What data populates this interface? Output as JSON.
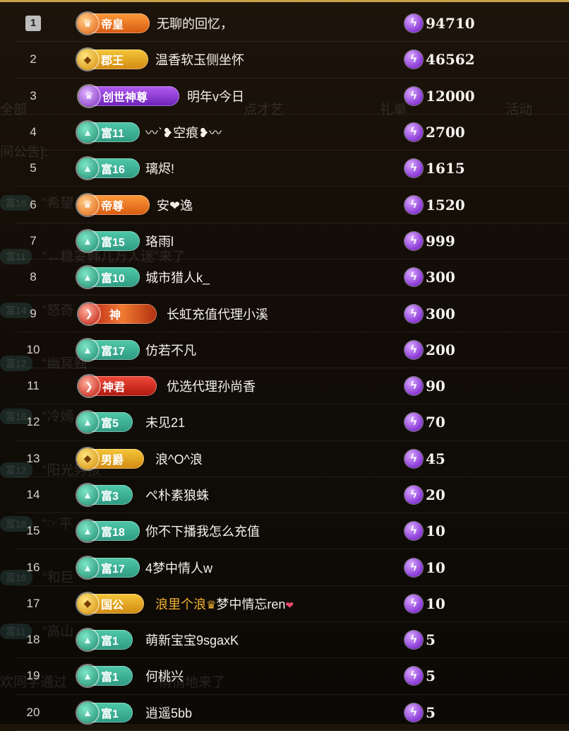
{
  "background": {
    "tabs": [
      "全部",
      "点才艺",
      "礼单",
      "活动"
    ],
    "announcement": "间公告]:",
    "chat_tags": [
      "富16",
      "富11",
      "富14",
      "富12",
      "富16",
      "富12",
      "富18",
      "富16",
      "富11"
    ],
    "chat_lines": [
      "“希望",
      "“↔稳妥韩几万人迷”来了",
      "“怒奇",
      "“幽冥独",
      "“冷嫣",
      "“阳光男孩",
      "“☞平",
      "“和巨",
      "“高山",
      "欢同学通过",
      "悄悄地来了"
    ]
  },
  "colors": {
    "accent_gold": "#c8a14a",
    "rich_badge": "#3fb596",
    "score_icon": "#8a3ad6"
  },
  "ranking": [
    {
      "rank": "1",
      "badge": "帝皇",
      "badge_type": "orange",
      "name": "无聊的回忆，",
      "score": "94710"
    },
    {
      "rank": "2",
      "badge": "郡王",
      "badge_type": "gold",
      "name": "温香软玉侧坐怀",
      "score": "46562"
    },
    {
      "rank": "3",
      "badge": "创世神尊",
      "badge_type": "purple",
      "name": "明年v今日",
      "score": "12000"
    },
    {
      "rank": "4",
      "badge": "富11",
      "badge_type": "rich",
      "name": "〰ˋ❥空痕❥〰",
      "score": "2700"
    },
    {
      "rank": "5",
      "badge": "富16",
      "badge_type": "rich",
      "name": "璃烬!",
      "score": "1615"
    },
    {
      "rank": "6",
      "badge": "帝尊",
      "badge_type": "orange",
      "name": "安❤逸",
      "score": "1520"
    },
    {
      "rank": "7",
      "badge": "富15",
      "badge_type": "rich",
      "name": "珞雨l",
      "score": "999"
    },
    {
      "rank": "8",
      "badge": "富10",
      "badge_type": "rich",
      "name": "城市猎人k_",
      "score": "300"
    },
    {
      "rank": "9",
      "badge": "神",
      "badge_type": "redwide",
      "name": "长虹充值代理小溪",
      "score": "300"
    },
    {
      "rank": "10",
      "badge": "富17",
      "badge_type": "rich",
      "name": "仿若不凡",
      "score": "200"
    },
    {
      "rank": "11",
      "badge": "神君",
      "badge_type": "red",
      "name": "优选代理孙尚香",
      "score": "90"
    },
    {
      "rank": "12",
      "badge": "富5",
      "badge_type": "rich",
      "name": "未见21",
      "score": "70"
    },
    {
      "rank": "13",
      "badge": "男爵",
      "badge_type": "gold",
      "name": "浪^O^浪",
      "score": "45"
    },
    {
      "rank": "14",
      "badge": "富3",
      "badge_type": "rich",
      "name": "ぺ朴素狼蛛",
      "score": "20"
    },
    {
      "rank": "15",
      "badge": "富18",
      "badge_type": "rich",
      "name": "你不下播我怎么充值",
      "score": "10"
    },
    {
      "rank": "16",
      "badge": "富17",
      "badge_type": "rich",
      "name": "4梦中情人w",
      "score": "10"
    },
    {
      "rank": "17",
      "badge": "国公",
      "badge_type": "gold",
      "name_gold": "浪里个浪",
      "name_rest": "梦中情忘ren",
      "score": "10"
    },
    {
      "rank": "18",
      "badge": "富1",
      "badge_type": "rich",
      "name": "萌新宝宝9sgaxK",
      "score": "5"
    },
    {
      "rank": "19",
      "badge": "富1",
      "badge_type": "rich",
      "name": "何桃兴",
      "score": "5"
    },
    {
      "rank": "20",
      "badge": "富1",
      "badge_type": "rich",
      "name": "逍遥5bb",
      "score": "5"
    }
  ]
}
